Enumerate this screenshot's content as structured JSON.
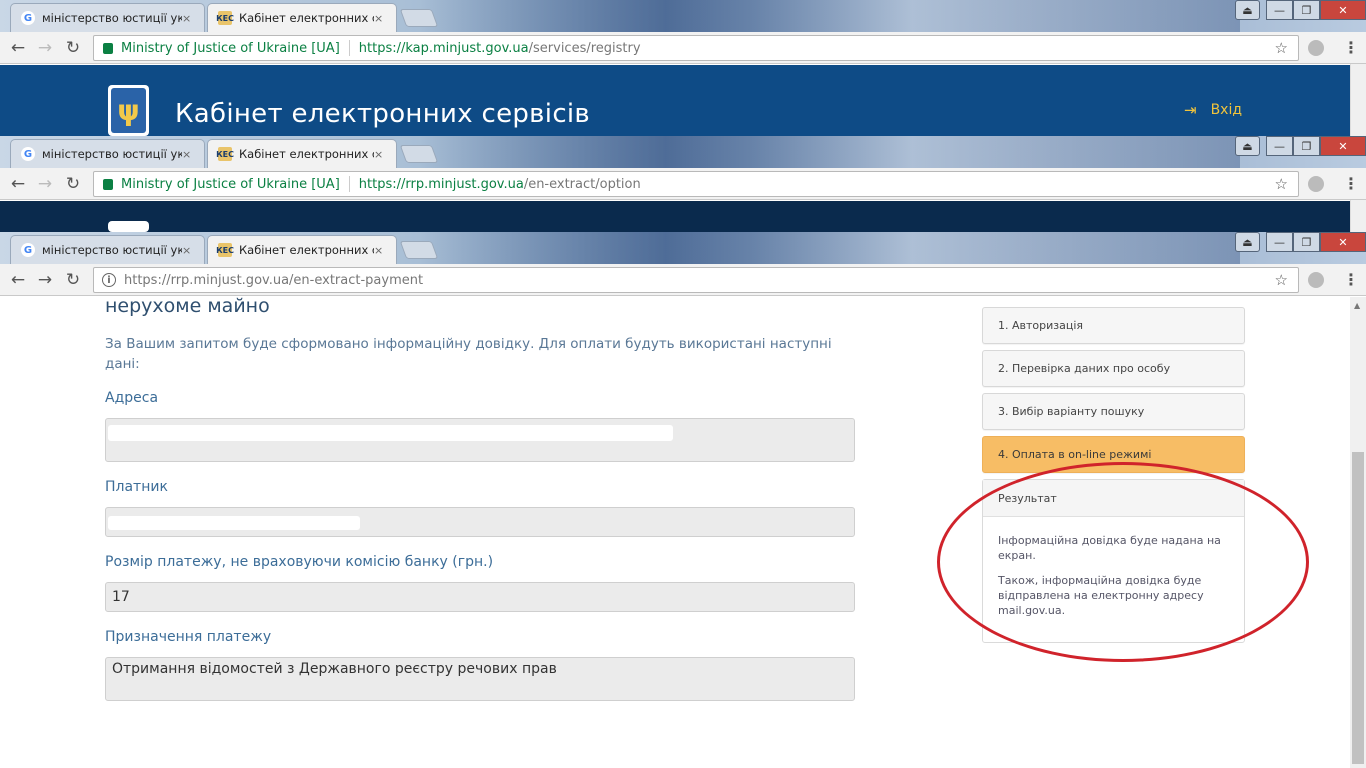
{
  "tabs": {
    "inactive_title": "міністерство юстиції укр",
    "active_title": "Кабінет електронних се",
    "close_glyph": "×"
  },
  "window_buttons": {
    "user": "⏏",
    "minimize": "—",
    "maximize": "❐",
    "close": "✕"
  },
  "window1": {
    "secure_label": "Ministry of Justice of Ukraine [UA]",
    "url_host": "https://kap.minjust.gov.ua",
    "url_path": "/services/registry",
    "brand_title": "Кабінет електронних сервісів",
    "login_label": "Вхід"
  },
  "window2": {
    "secure_label": "Ministry of Justice of Ukraine [UA]",
    "url_host": "https://rrp.minjust.gov.ua",
    "url_path": "/en-extract/option"
  },
  "window3": {
    "url_host": "https://rrp.minjust.gov.ua",
    "url_path": "/en-extract-payment",
    "page_heading": "нерухоме майно",
    "intro_text": "За Вашим запитом буде сформовано інформаційну довідку. Для оплати будуть використані наступні дані:",
    "fields": {
      "address_label": "Адреса",
      "payer_label": "Платник",
      "amount_label": "Розмір платежу, не враховуючи комісію банку (грн.)",
      "amount_value": "17",
      "purpose_label": "Призначення платежу",
      "purpose_value": "Отримання відомостей з Державного реєстру речових прав"
    },
    "steps": [
      {
        "label": "1. Авторизація"
      },
      {
        "label": "2. Перевірка даних про особу"
      },
      {
        "label": "3. Вибір варіанту пошуку"
      },
      {
        "label": "4. Оплата в on-line режимі"
      }
    ],
    "result": {
      "title": "Результат",
      "text1": "Інформаційна довідка буде надана на екран.",
      "text2": "Також, інформаційна довідка буде відправлена на електронну адресу mail.gov.ua."
    }
  },
  "colors": {
    "banner_blue": "#0e4b86",
    "active_step": "#f7bd65",
    "annotation_red": "#d0232b",
    "secure_green": "#0b8043"
  }
}
